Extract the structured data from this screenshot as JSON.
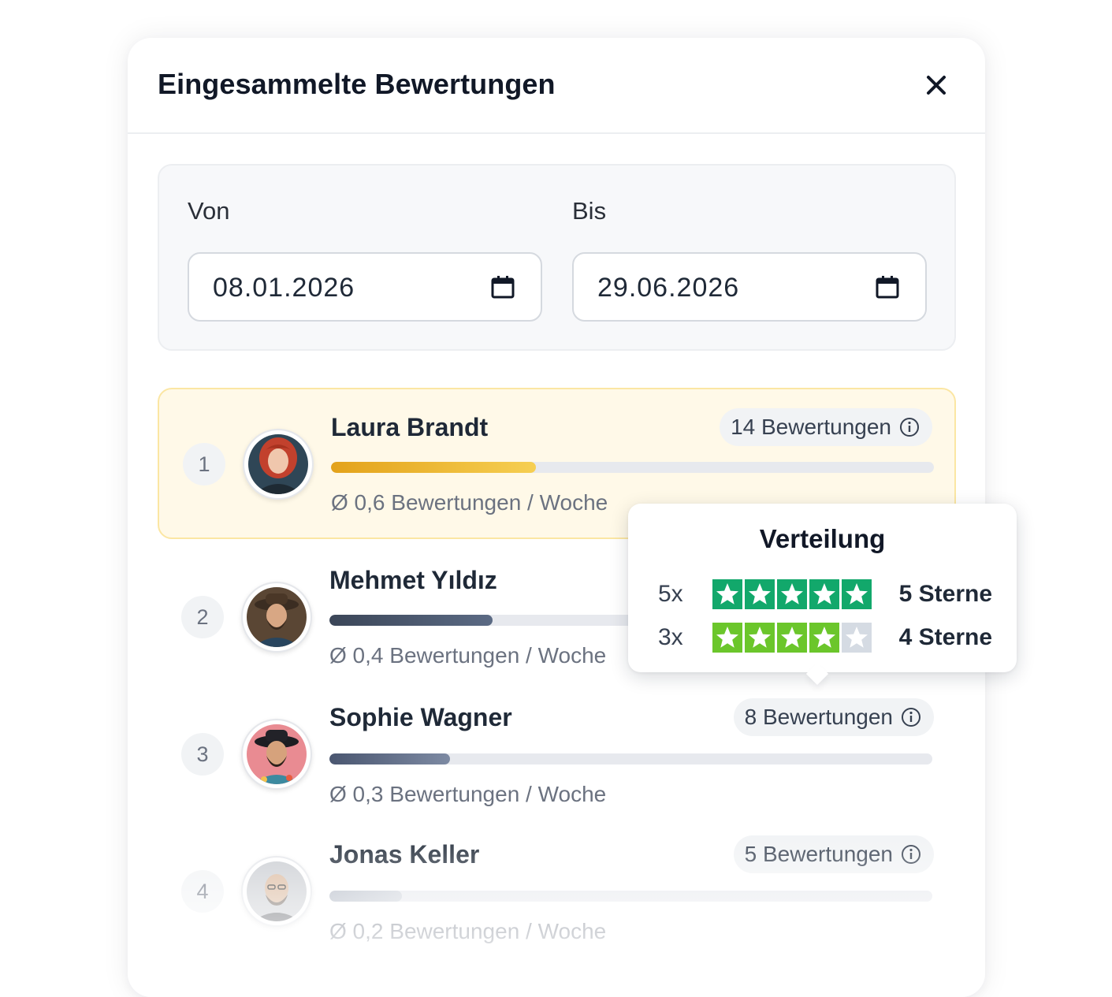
{
  "modal": {
    "title": "Eingesammelte Bewertungen",
    "close_icon": "close-icon"
  },
  "date_range": {
    "from_label": "Von",
    "from_value": "08.01.2026",
    "to_label": "Bis",
    "to_value": "29.06.2026",
    "icon": "calendar-icon"
  },
  "ranking": [
    {
      "rank": "1",
      "name": "Laura Brandt",
      "count_label": "14 Bewertungen",
      "weekly_label": "Ø 0,6 Bewertungen / Woche",
      "progress": 0.34,
      "highlighted": true,
      "bar_color_start": "#e3a21a",
      "bar_color_end": "#f6cf52"
    },
    {
      "rank": "2",
      "name": "Mehmet Yıldız",
      "count_label": "",
      "weekly_label": "Ø 0,4 Bewertungen / Woche",
      "progress": 0.27,
      "highlighted": false,
      "bar_color_start": "#3b4658",
      "bar_color_end": "#5b6a84"
    },
    {
      "rank": "3",
      "name": "Sophie Wagner",
      "count_label": "8 Bewertungen",
      "weekly_label": "Ø 0,3 Bewertungen / Woche",
      "progress": 0.2,
      "highlighted": false,
      "bar_color_start": "#4a5670",
      "bar_color_end": "#7d8aa3"
    },
    {
      "rank": "4",
      "name": "Jonas Keller",
      "count_label": "5 Bewertungen",
      "weekly_label": "Ø 0,2 Bewertungen / Woche",
      "progress": 0.12,
      "highlighted": false,
      "bar_color_start": "#aeb5c2",
      "bar_color_end": "#cdd2da"
    }
  ],
  "tooltip": {
    "title": "Verteilung",
    "rows": [
      {
        "count": "5x",
        "stars": 5,
        "label": "5 Sterne",
        "color": "#12a86b"
      },
      {
        "count": "3x",
        "stars": 4,
        "label": "4 Sterne",
        "color": "#6bc62b"
      }
    ],
    "empty_star_color": "#d5dbe3"
  },
  "colors": {
    "highlight_bg": "#fff9e8",
    "highlight_border": "#fbe6a3",
    "track": "#e7e9ee"
  }
}
